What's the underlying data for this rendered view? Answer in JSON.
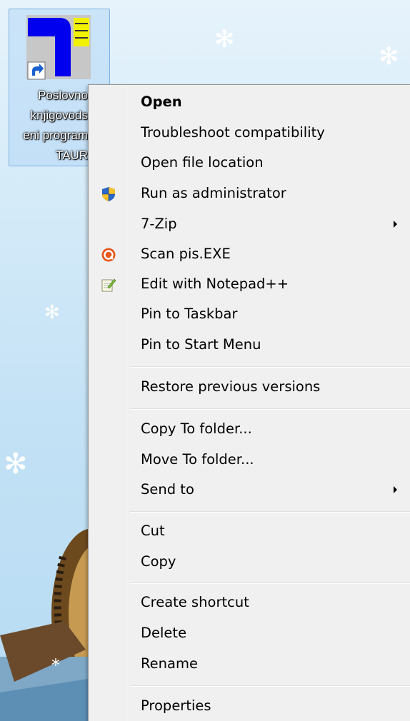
{
  "desktop": {
    "shortcut": {
      "caption_lines": [
        "Poslovno",
        "knjigovods",
        "eni program",
        "TAUR"
      ],
      "icon": "taur-shortcut-icon"
    }
  },
  "context_menu": {
    "items": [
      {
        "label": "Open",
        "bold": true
      },
      {
        "label": "Troubleshoot compatibility"
      },
      {
        "label": "Open file location"
      },
      {
        "label": "Run as administrator",
        "icon": "uac-shield-icon"
      },
      {
        "label": "7-Zip",
        "submenu": true
      },
      {
        "label": "Scan pis.EXE",
        "icon": "antivirus-icon"
      },
      {
        "label": "Edit with Notepad++",
        "icon": "notepad-plus-plus-icon"
      },
      {
        "label": "Pin to Taskbar"
      },
      {
        "label": "Pin to Start Menu"
      },
      {
        "label": "Restore previous versions"
      },
      {
        "label": "Copy To folder..."
      },
      {
        "label": "Move To folder..."
      },
      {
        "label": "Send to",
        "submenu": true
      },
      {
        "label": "Cut"
      },
      {
        "label": "Copy"
      },
      {
        "label": "Create shortcut"
      },
      {
        "label": "Delete"
      },
      {
        "label": "Rename"
      },
      {
        "label": "Properties"
      }
    ]
  },
  "colors": {
    "menu_background": "#f0f0f0",
    "menu_border": "#979797",
    "shortcut_blue": "#0000ee",
    "shortcut_yellow": "#f2f200"
  }
}
